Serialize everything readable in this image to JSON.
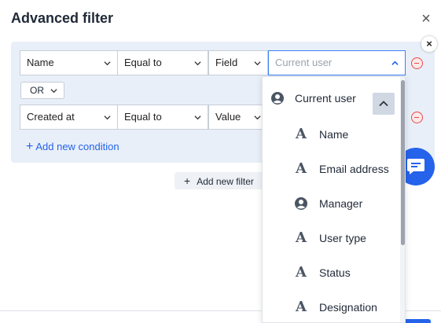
{
  "dialog": {
    "title": "Advanced filter",
    "close_glyph": "×"
  },
  "conditions": [
    {
      "field": "Name",
      "operator": "Equal to",
      "type": "Field",
      "value_placeholder": "Current user"
    },
    {
      "field": "Created at",
      "operator": "Equal to",
      "type": "Value"
    }
  ],
  "logic_operator": "OR",
  "add_condition_label": "Add new condition",
  "add_filter_label": "Add new filter",
  "badge_close_glyph": "×",
  "dropdown": {
    "header": {
      "label": "Current user",
      "icon": "user-icon"
    },
    "items": [
      {
        "label": "Name",
        "icon": "text-type-icon"
      },
      {
        "label": "Email address",
        "icon": "text-type-icon"
      },
      {
        "label": "Manager",
        "icon": "user-icon"
      },
      {
        "label": "User type",
        "icon": "text-type-icon"
      },
      {
        "label": "Status",
        "icon": "text-type-icon"
      },
      {
        "label": "Designation",
        "icon": "text-type-icon"
      }
    ]
  },
  "colors": {
    "accent": "#2563eb",
    "panel_bg": "#e9eff8",
    "remove_red": "#e5484d"
  }
}
